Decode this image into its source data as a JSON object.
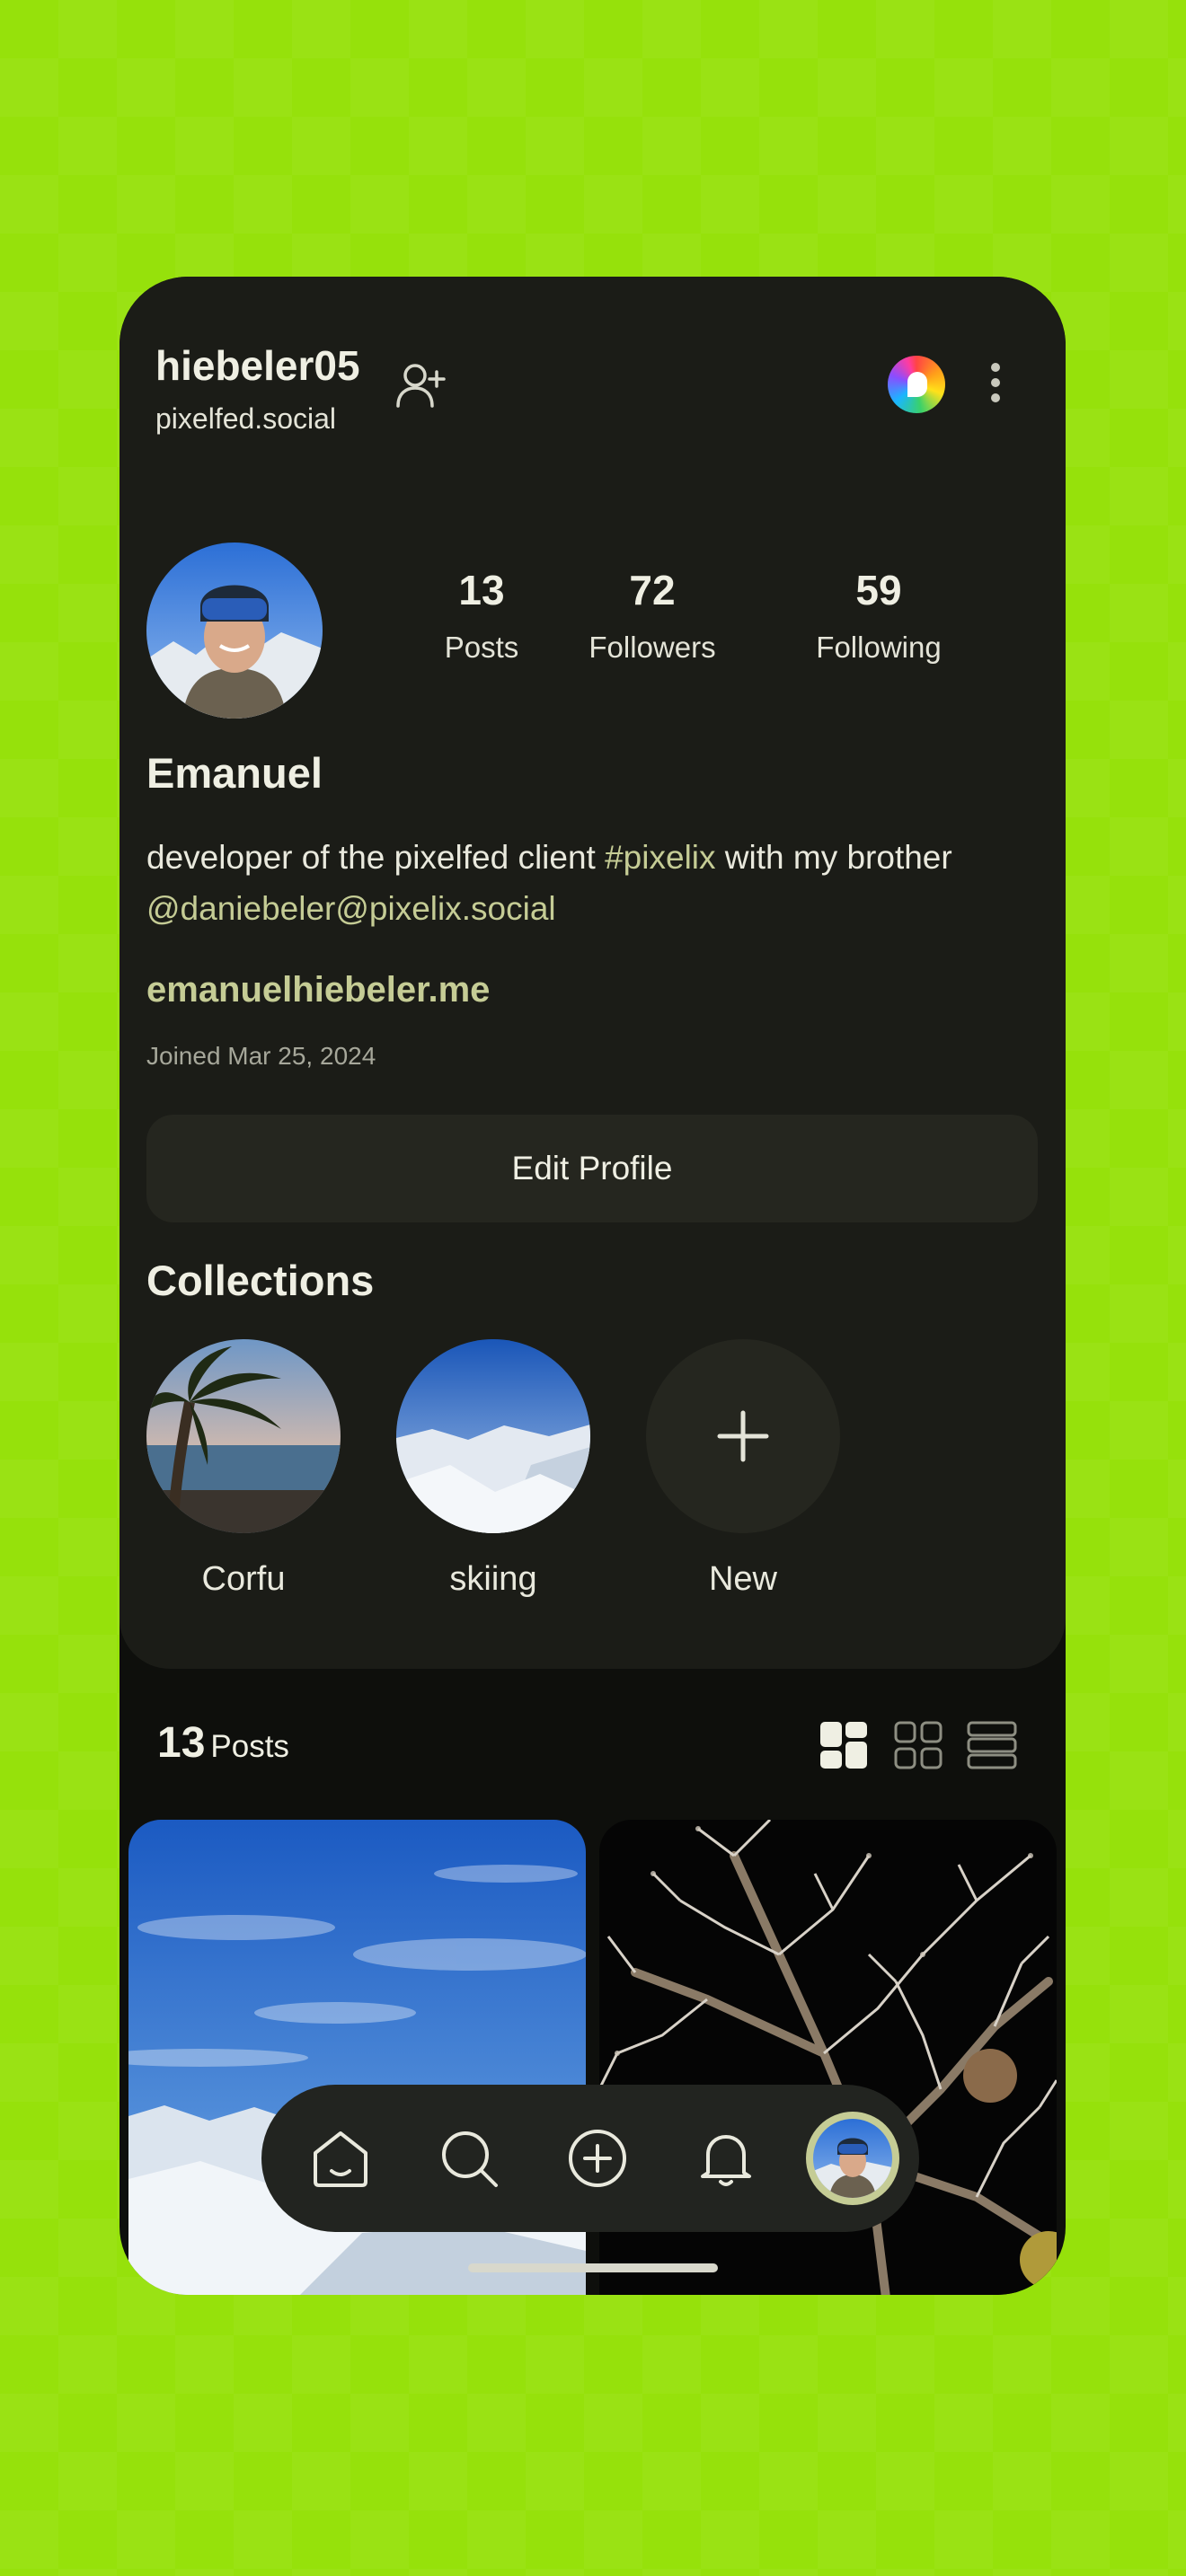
{
  "header": {
    "username": "hiebeler05",
    "server": "pixelfed.social"
  },
  "stats": [
    {
      "value": "13",
      "label": "Posts"
    },
    {
      "value": "72",
      "label": "Followers"
    },
    {
      "value": "59",
      "label": "Following"
    }
  ],
  "profile": {
    "display_name": "Emanuel",
    "bio_text_1": "developer of the pixelfed client ",
    "bio_hashtag": "#pixelix",
    "bio_text_2": " with my brother",
    "bio_mention": "@daniebeler@pixelix.social",
    "website": "emanuelhiebeler.me",
    "joined": "Joined Mar 25, 2024",
    "edit_button": "Edit Profile"
  },
  "collections": {
    "title": "Collections",
    "items": [
      {
        "label": "Corfu"
      },
      {
        "label": "skiing"
      },
      {
        "label": "New"
      }
    ]
  },
  "posts_bar": {
    "count": "13",
    "label": "Posts"
  },
  "nav": {
    "items": [
      "home-icon",
      "search-icon",
      "add-post-icon",
      "notifications-icon",
      "profile-avatar"
    ]
  },
  "colors": {
    "background": "#96e10b",
    "surface": "#1b1c17",
    "accent": "#c5cc95",
    "text": "#efefe3"
  }
}
